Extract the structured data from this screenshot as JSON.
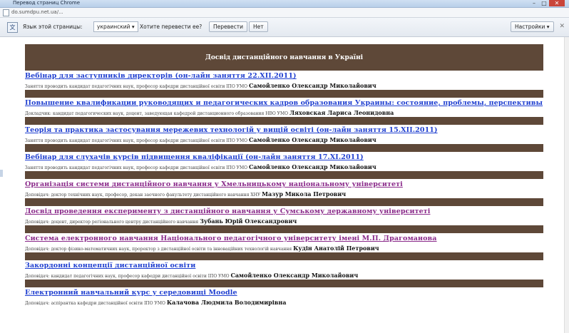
{
  "window": {
    "title": "Перевод страниц Chrome",
    "minimize": "–",
    "maximize": "□",
    "close": "✕"
  },
  "address": {
    "url": "do.sumdpu.net.ua/..."
  },
  "translate_bar": {
    "icon": "文",
    "language_label": "Язык этой страницы:",
    "language_value": "украинский ▾",
    "question": "Хотите перевести ее?",
    "translate_button": "Перевести",
    "no_button": "Нет",
    "settings_button": "Настройки ▾",
    "close": "✕"
  },
  "page": {
    "header_title": "Досвід дистанційного навчання в Україні",
    "entries": [
      {
        "title": "Вебінар для заступників директорів (он-лайн заняття 22.XII.2011)",
        "color": "blue",
        "desc": "Заняття проводить кандидат педагогічних наук, професор кафедри дистанційної освіти ІПО УМО ",
        "author": "Самойленко Олександр Миколайович"
      },
      {
        "title": "Повышение квалификации руководящих и педагогических кадров образования Украины: состояние, проблемы, перспективы",
        "color": "blue",
        "desc": "Докладчик: кандидат педагогических наук, доцент, заведующая кафедрой дистанционного образования НВО УМО ",
        "author": "Ляховская Лариса Леонидовна"
      },
      {
        "title": "Теорія та практика застосування мережевих технологій у вищій освіті (он-лайн заняття 15.XII.2011)",
        "color": "blue",
        "desc": "Заняття проводить кандидат педагогічних наук, професор кафедри дистанційної освіти ІПО УМО ",
        "author": "Самойленко Олександр Миколайович"
      },
      {
        "title": "Вебінар для слухачів курсів підвищення кваліфікації (он-лайн заняття 17.XI.2011)",
        "color": "blue",
        "desc": "Заняття проводить кандидат педагогічних наук, професор кафедри дистанційної освіти ІПО УМО ",
        "author": "Самойленко Олександр Миколайович"
      },
      {
        "title": "Організація системи дистанційного навчання у Хмельницькому національному університеті",
        "color": "purple",
        "desc": "Доповідач: доктор технічних наук, професор, декан заочного факультету дистанційного навчання ХНУ ",
        "author": "Мазур Микола Петрович"
      },
      {
        "title": "Досвід проведення експерименту з дистанційного навчання у Сумському державному університеті",
        "color": "purple",
        "desc": "Доповідач: доцент, директор регіонального центру дистанційного навчання ",
        "author": "Зубань Юрій Олександрович"
      },
      {
        "title": "Система електронного навчання Національного педагогічного університету імені М.П. Драгоманова",
        "color": "purple",
        "desc": "Доповідач: доктор фізико-математичних наук, проректор з дистанційної освіти та інноваційних технологій навчання ",
        "author": "Кудін Анатолій Петрович"
      },
      {
        "title": "Закордонні концепції дистанційної освіти",
        "color": "blue",
        "desc": "Доповідач: кандидат педагогічних наук, професор кафедри дистанційної освіти ІПО УМО ",
        "author": "Самойленко Олександр Миколайович"
      },
      {
        "title": "Електронний навчальний курс у середовищі Moodle",
        "color": "blue",
        "desc": "Доповідач: аспірантка кафедри дистанційної освіти ІПО УМО ",
        "author": "Калачова Людмила Володимирівна"
      }
    ]
  }
}
